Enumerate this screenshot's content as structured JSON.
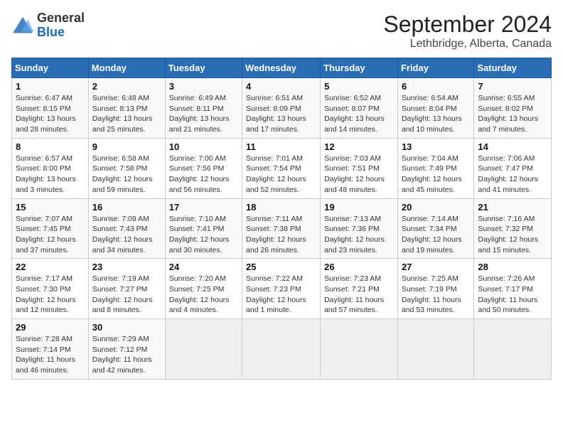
{
  "logo": {
    "general": "General",
    "blue": "Blue"
  },
  "title": "September 2024",
  "subtitle": "Lethbridge, Alberta, Canada",
  "headers": [
    "Sunday",
    "Monday",
    "Tuesday",
    "Wednesday",
    "Thursday",
    "Friday",
    "Saturday"
  ],
  "weeks": [
    [
      {
        "day": "1",
        "info": "Sunrise: 6:47 AM\nSunset: 8:15 PM\nDaylight: 13 hours and 28 minutes."
      },
      {
        "day": "2",
        "info": "Sunrise: 6:48 AM\nSunset: 8:13 PM\nDaylight: 13 hours and 25 minutes."
      },
      {
        "day": "3",
        "info": "Sunrise: 6:49 AM\nSunset: 8:11 PM\nDaylight: 13 hours and 21 minutes."
      },
      {
        "day": "4",
        "info": "Sunrise: 6:51 AM\nSunset: 8:09 PM\nDaylight: 13 hours and 17 minutes."
      },
      {
        "day": "5",
        "info": "Sunrise: 6:52 AM\nSunset: 8:07 PM\nDaylight: 13 hours and 14 minutes."
      },
      {
        "day": "6",
        "info": "Sunrise: 6:54 AM\nSunset: 8:04 PM\nDaylight: 13 hours and 10 minutes."
      },
      {
        "day": "7",
        "info": "Sunrise: 6:55 AM\nSunset: 8:02 PM\nDaylight: 13 hours and 7 minutes."
      }
    ],
    [
      {
        "day": "8",
        "info": "Sunrise: 6:57 AM\nSunset: 8:00 PM\nDaylight: 13 hours and 3 minutes."
      },
      {
        "day": "9",
        "info": "Sunrise: 6:58 AM\nSunset: 7:58 PM\nDaylight: 12 hours and 59 minutes."
      },
      {
        "day": "10",
        "info": "Sunrise: 7:00 AM\nSunset: 7:56 PM\nDaylight: 12 hours and 56 minutes."
      },
      {
        "day": "11",
        "info": "Sunrise: 7:01 AM\nSunset: 7:54 PM\nDaylight: 12 hours and 52 minutes."
      },
      {
        "day": "12",
        "info": "Sunrise: 7:03 AM\nSunset: 7:51 PM\nDaylight: 12 hours and 48 minutes."
      },
      {
        "day": "13",
        "info": "Sunrise: 7:04 AM\nSunset: 7:49 PM\nDaylight: 12 hours and 45 minutes."
      },
      {
        "day": "14",
        "info": "Sunrise: 7:06 AM\nSunset: 7:47 PM\nDaylight: 12 hours and 41 minutes."
      }
    ],
    [
      {
        "day": "15",
        "info": "Sunrise: 7:07 AM\nSunset: 7:45 PM\nDaylight: 12 hours and 37 minutes."
      },
      {
        "day": "16",
        "info": "Sunrise: 7:09 AM\nSunset: 7:43 PM\nDaylight: 12 hours and 34 minutes."
      },
      {
        "day": "17",
        "info": "Sunrise: 7:10 AM\nSunset: 7:41 PM\nDaylight: 12 hours and 30 minutes."
      },
      {
        "day": "18",
        "info": "Sunrise: 7:11 AM\nSunset: 7:38 PM\nDaylight: 12 hours and 26 minutes."
      },
      {
        "day": "19",
        "info": "Sunrise: 7:13 AM\nSunset: 7:36 PM\nDaylight: 12 hours and 23 minutes."
      },
      {
        "day": "20",
        "info": "Sunrise: 7:14 AM\nSunset: 7:34 PM\nDaylight: 12 hours and 19 minutes."
      },
      {
        "day": "21",
        "info": "Sunrise: 7:16 AM\nSunset: 7:32 PM\nDaylight: 12 hours and 15 minutes."
      }
    ],
    [
      {
        "day": "22",
        "info": "Sunrise: 7:17 AM\nSunset: 7:30 PM\nDaylight: 12 hours and 12 minutes."
      },
      {
        "day": "23",
        "info": "Sunrise: 7:19 AM\nSunset: 7:27 PM\nDaylight: 12 hours and 8 minutes."
      },
      {
        "day": "24",
        "info": "Sunrise: 7:20 AM\nSunset: 7:25 PM\nDaylight: 12 hours and 4 minutes."
      },
      {
        "day": "25",
        "info": "Sunrise: 7:22 AM\nSunset: 7:23 PM\nDaylight: 12 hours and 1 minute."
      },
      {
        "day": "26",
        "info": "Sunrise: 7:23 AM\nSunset: 7:21 PM\nDaylight: 11 hours and 57 minutes."
      },
      {
        "day": "27",
        "info": "Sunrise: 7:25 AM\nSunset: 7:19 PM\nDaylight: 11 hours and 53 minutes."
      },
      {
        "day": "28",
        "info": "Sunrise: 7:26 AM\nSunset: 7:17 PM\nDaylight: 11 hours and 50 minutes."
      }
    ],
    [
      {
        "day": "29",
        "info": "Sunrise: 7:28 AM\nSunset: 7:14 PM\nDaylight: 11 hours and 46 minutes."
      },
      {
        "day": "30",
        "info": "Sunrise: 7:29 AM\nSunset: 7:12 PM\nDaylight: 11 hours and 42 minutes."
      },
      null,
      null,
      null,
      null,
      null
    ]
  ]
}
